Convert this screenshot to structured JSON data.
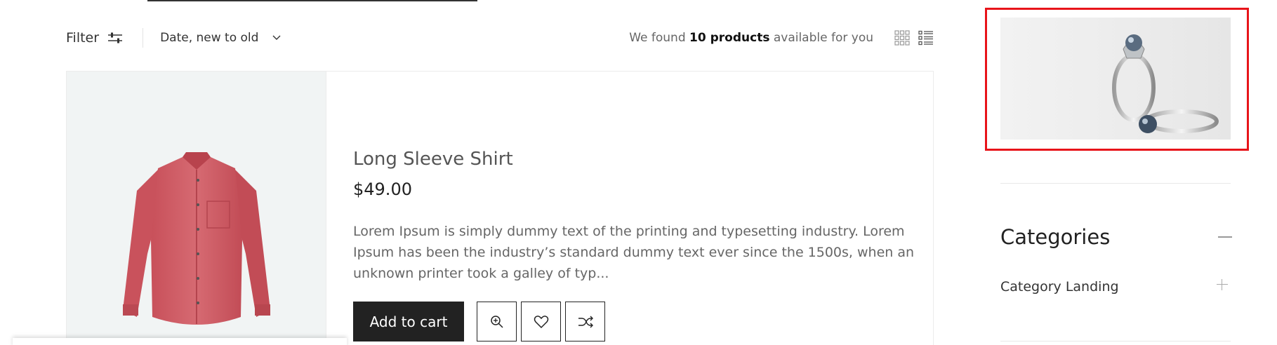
{
  "toolbar": {
    "filter_label": "Filter",
    "sort_label": "Date, new to old",
    "result_prefix": "We found ",
    "result_count": "10 products",
    "result_suffix": " available for you"
  },
  "product": {
    "title": "Long Sleeve Shirt",
    "price": "$49.00",
    "description": "Lorem Ipsum is simply dummy text of the printing and typesetting industry. Lorem Ipsum has been the industry’s standard dummy text ever since the 1500s, when an unknown printer took a galley of typ...",
    "add_to_cart_label": "Add to cart",
    "image_color": "#d35c64"
  },
  "sidebar": {
    "categories_title": "Categories",
    "categories": [
      {
        "label": "Category Landing"
      }
    ]
  },
  "colors": {
    "highlight": "#e8141a",
    "button_dark": "#222222"
  },
  "icons": [
    "filter-sliders-icon",
    "chevron-down-icon",
    "grid-view-icon",
    "list-view-icon",
    "zoom-in-icon",
    "heart-icon",
    "shuffle-compare-icon",
    "minus-icon",
    "plus-icon"
  ]
}
